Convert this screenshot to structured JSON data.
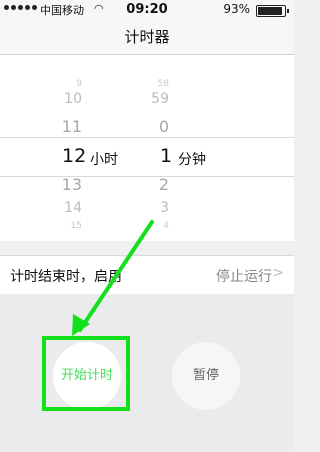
{
  "status": {
    "carrier": "中国移动",
    "time": "09:20",
    "battery": "93%"
  },
  "nav": {
    "title": "计时器"
  },
  "picker": {
    "hours": [
      "9",
      "10",
      "11",
      "13",
      "14",
      "15"
    ],
    "minutes": [
      "58",
      "59",
      "0",
      "2",
      "3",
      "4"
    ],
    "selected_hour": "12",
    "hour_unit": "小时",
    "selected_minute": "1",
    "minute_unit": "分钟"
  },
  "settings": {
    "when_done_label": "计时结束时，启用",
    "when_done_value": "停止运行"
  },
  "controls": {
    "start_label": "开始计时",
    "pause_label": "暂停"
  },
  "colors": {
    "start_text": "#4cd964",
    "annotation": "#11e01a"
  }
}
